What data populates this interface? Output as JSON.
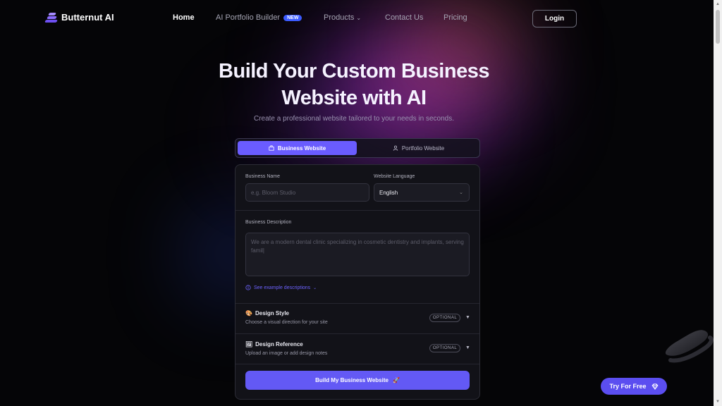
{
  "brand": {
    "name": "Butternut AI",
    "logo_icon": "butternut-logo-icon"
  },
  "nav": {
    "links": [
      {
        "label": "Home",
        "active": true
      },
      {
        "label": "AI Portfolio Builder",
        "badge": "NEW"
      },
      {
        "label": "Products",
        "has_dropdown": true
      },
      {
        "label": "Contact Us"
      },
      {
        "label": "Pricing"
      }
    ],
    "login_label": "Login"
  },
  "hero": {
    "title_line1": "Build Your Custom Business",
    "title_line2": "Website with AI",
    "subtitle": "Create a professional website tailored to your needs in seconds."
  },
  "tabs": [
    {
      "label": "Business Website",
      "icon": "building-icon",
      "active": true
    },
    {
      "label": "Portfolio Website",
      "icon": "user-icon",
      "active": false
    }
  ],
  "form": {
    "business_name": {
      "label": "Business Name",
      "placeholder": "e.g. Bloom Studio",
      "value": ""
    },
    "language": {
      "label": "Website Language",
      "value": "English"
    },
    "description": {
      "label": "Business Description",
      "text": "We are a modern dental clinic specializing in cosmetic dentistry and implants, serving famil|"
    },
    "see_examples": "See example descriptions",
    "design_style": {
      "title": "Design Style",
      "icon": "palette-icon",
      "desc": "Choose a visual direction for your site",
      "tag": "OPTIONAL"
    },
    "design_reference": {
      "title": "Design Reference",
      "icon": "image-icon",
      "desc": "Upload an image or add design notes",
      "tag": "OPTIONAL"
    },
    "submit_label": "Build My Business Website",
    "submit_icon": "rocket-icon"
  },
  "floating": {
    "try_label": "Try For Free",
    "try_icon": "diamond-icon"
  },
  "colors": {
    "accent": "#6359f5",
    "tab_active": "#6a5cff",
    "new_badge": "#3b5bff",
    "background": "#050507"
  }
}
